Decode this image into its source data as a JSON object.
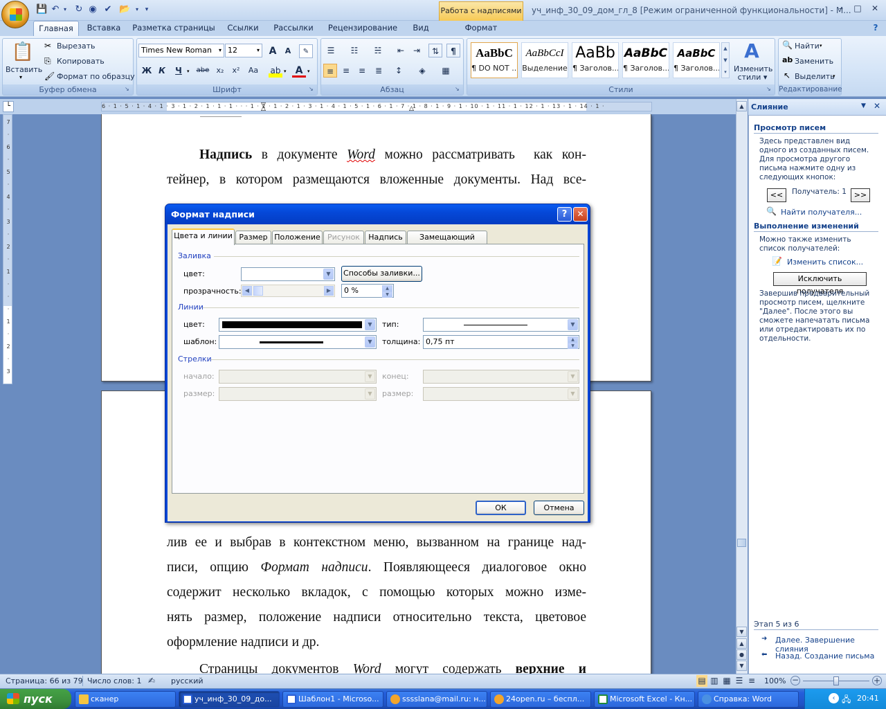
{
  "window": {
    "title": "уч_инф_30_09_дом_гл_8 [Режим ограниченной функциональности] - M...",
    "context_tab_group": "Работа с надписями",
    "minimize": "–",
    "maximize": "□",
    "close": "✕"
  },
  "ribbon_tabs": [
    "Главная",
    "Вставка",
    "Разметка страницы",
    "Ссылки",
    "Рассылки",
    "Рецензирование",
    "Вид",
    "Формат"
  ],
  "ribbon": {
    "clipboard": {
      "label": "Буфер обмена",
      "paste": "Вставить",
      "cut": "Вырезать",
      "copy": "Копировать",
      "format_painter": "Формат по образцу"
    },
    "font": {
      "label": "Шрифт",
      "font_name": "Times New Roman",
      "font_size": "12",
      "bold": "Ж",
      "italic": "К",
      "underline": "Ч",
      "strike": "abe",
      "sub": "x₂",
      "sup": "x²",
      "case": "Aa",
      "grow": "A",
      "shrink": "A"
    },
    "paragraph": {
      "label": "Абзац",
      "pilcrow": "¶"
    },
    "styles": {
      "label": "Стили",
      "items": [
        {
          "preview": "AaBbC",
          "name": "¶ DO NOT ..."
        },
        {
          "preview": "AaBbCcI",
          "name": "Выделение"
        },
        {
          "preview": "AaBb",
          "name": "¶ Заголов..."
        },
        {
          "preview": "AaBbC",
          "name": "¶ Заголов..."
        },
        {
          "preview": "AaBbC",
          "name": "¶ Заголов..."
        }
      ],
      "change_styles_line1": "Изменить",
      "change_styles_line2": "стили"
    },
    "editing": {
      "label": "Редактирование",
      "find": "Найти",
      "replace": "Заменить",
      "select": "Выделить"
    }
  },
  "ruler": {
    "ticks": "6 · 1 · 5 · 1 · 4 · 1 · 3 · 1 · 2 · 1 · 1 · 1 · · · 1 · 1 · 1 · 2 · 1 · 3 · 1 · 4 · 1 · 5 · 1 · 6 · 1 · 7 · 1 · 8 · 1 · 9 · 1 · 10 · 1 · 11 · 1 · 12 · 1 · 13 · 1 · 14 · 1 ·",
    "vticks": [
      "7",
      "·",
      "6",
      "·",
      "5",
      "·",
      "4",
      "·",
      "3",
      "·",
      "2",
      "·",
      "1",
      "·",
      "·",
      "·",
      "1",
      "·",
      "2",
      "·",
      "3"
    ]
  },
  "document": {
    "para1": [
      "Надпись в документе Word можно рассматривать  как кон-",
      "тейнер, в котором размещаются вложенные документы. Над все-"
    ],
    "para1_bold": "Надпись",
    "para1_italic": "Word",
    "para2": [
      "лив ее и выбрав в контекстном меню, вызванном на границе над-",
      "писи, опцию Формат надписи. Появляющееся диалоговое окно",
      "содержит несколько вкладок, с помощью которых можно изме-",
      "нять размер, положение надписи относительно текста, цветовое",
      "оформление надписи и др."
    ],
    "para3": "Страницы документов Word могут содержать верхние и"
  },
  "dialog": {
    "title": "Формат надписи",
    "help": "?",
    "close": "✕",
    "tabs": [
      {
        "label": "Цвета и линии",
        "active": true,
        "disabled": false
      },
      {
        "label": "Размер",
        "active": false,
        "disabled": false
      },
      {
        "label": "Положение",
        "active": false,
        "disabled": false
      },
      {
        "label": "Рисунок",
        "active": false,
        "disabled": true
      },
      {
        "label": "Надпись",
        "active": false,
        "disabled": false
      },
      {
        "label": "Замещающий текст",
        "active": false,
        "disabled": false
      }
    ],
    "fill": {
      "section": "Заливка",
      "color_label": "цвет:",
      "color_value": "",
      "fill_effects": "Способы заливки...",
      "transparency_label": "прозрачность:",
      "transparency_value": "0 %",
      "transparency_level": 0
    },
    "lines": {
      "section": "Линии",
      "color_label": "цвет:",
      "color_value": "#000000",
      "type_label": "тип:",
      "pattern_label": "шаблон:",
      "weight_label": "толщина:",
      "weight_value": "0,75 пт"
    },
    "arrows": {
      "section": "Стрелки",
      "begin_label": "начало:",
      "end_label": "конец:",
      "begin_size_label": "размер:",
      "end_size_label": "размер:"
    },
    "ok": "ОК",
    "cancel": "Отмена"
  },
  "task_pane": {
    "title": "Слияние",
    "preview_heading": "Просмотр писем",
    "preview_text": "Здесь представлен вид одного из созданных писем. Для просмотра другого письма нажмите одну из следующих кнопок:",
    "prev": "<<",
    "recipient": "Получатель: 1",
    "next": ">>",
    "find_recipient": "Найти получателя...",
    "changes_heading": "Выполнение изменений",
    "changes_text": "Можно также изменить список получателей:",
    "edit_list": "Изменить список...",
    "exclude": "Исключить получателя",
    "finish_text": "Завершив предварительный просмотр писем, щелкните \"Далее\". После этого вы сможете напечатать письма или отредактировать их по отдельности.",
    "step": "Этап 5 из 6",
    "next_step": "Далее. Завершение слияния",
    "prev_step": "Назад. Создание письма"
  },
  "status_bar": {
    "page": "Страница: 66 из 79",
    "words": "Число слов: 1",
    "language": "русский",
    "zoom": "100%"
  },
  "taskbar": {
    "start": "пуск",
    "items": [
      {
        "label": "сканер",
        "color": "#f5c542"
      },
      {
        "label": "уч_инф_30_09_до...",
        "color": "#2b5fd6"
      },
      {
        "label": "Шаблон1 - Microso...",
        "color": "#2b5fd6"
      },
      {
        "label": "sssslana@mail.ru: н...",
        "color": "#f2a52c"
      },
      {
        "label": "24open.ru – беспл...",
        "color": "#f2a52c"
      },
      {
        "label": "Microsoft Excel - Кн...",
        "color": "#1f8a3c"
      },
      {
        "label": "Справка: Word",
        "color": "#4a90e2"
      }
    ],
    "lang": "RU",
    "clock": "20:41"
  }
}
